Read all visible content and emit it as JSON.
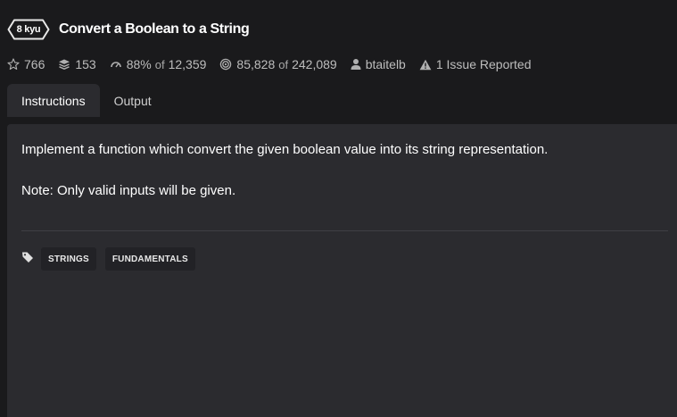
{
  "kata": {
    "rank": "8 kyu",
    "title": "Convert a Boolean to a String"
  },
  "stats": {
    "stars": "766",
    "collections": "153",
    "satisfaction_pct": "88%",
    "satisfaction_of": "of",
    "satisfaction_votes": "12,359",
    "completed": "85,828",
    "completed_of": "of",
    "attempted": "242,089",
    "author": "btaitelb",
    "issues": "1 Issue Reported"
  },
  "tabs": [
    {
      "label": "Instructions",
      "active": true
    },
    {
      "label": "Output",
      "active": false
    }
  ],
  "description": {
    "line1": "Implement a function which convert the given boolean value into its string representation.",
    "line2": "Note: Only valid inputs will be given."
  },
  "tags": [
    "STRINGS",
    "FUNDAMENTALS"
  ],
  "icons": {
    "stars": "star-icon",
    "collections": "stack-icon",
    "satisfaction": "gauge-icon",
    "completed": "target-icon",
    "author": "user-icon",
    "issues": "warning-icon",
    "tags": "tag-icon"
  },
  "colors": {
    "background": "#1a1a1c",
    "panel": "#2b2b2f",
    "tag_bg": "#222226",
    "text": "#ffffff",
    "muted": "#bdbdbd"
  }
}
